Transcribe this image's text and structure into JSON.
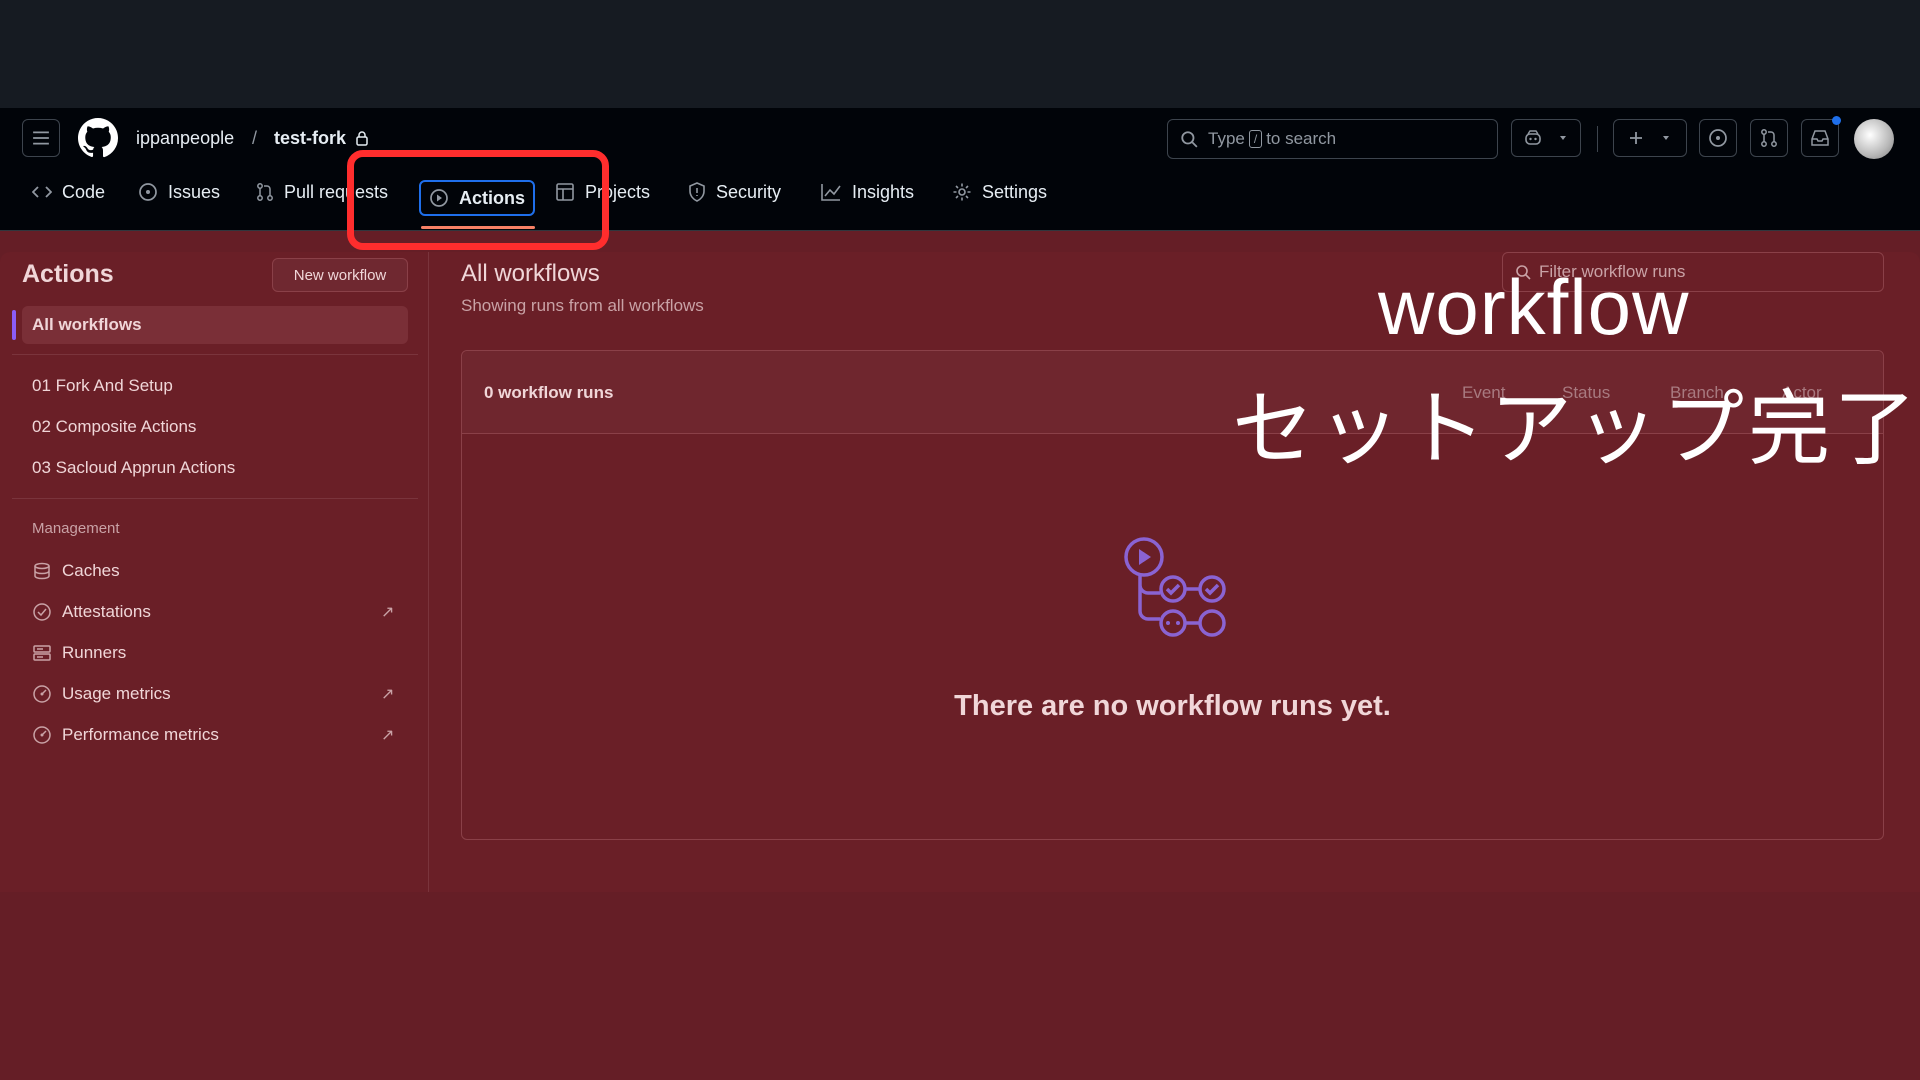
{
  "header": {
    "owner": "ippanpeople",
    "separator": "/",
    "repo": "test-fork",
    "search_prefix": "Type",
    "search_key": "/",
    "search_suffix": "to search"
  },
  "nav": {
    "tabs": [
      {
        "label": "Code",
        "icon": "code-icon"
      },
      {
        "label": "Issues",
        "icon": "issue-icon"
      },
      {
        "label": "Pull requests",
        "icon": "pull-request-icon"
      },
      {
        "label": "Actions",
        "icon": "play-icon",
        "active": true
      },
      {
        "label": "Projects",
        "icon": "table-icon"
      },
      {
        "label": "Security",
        "icon": "shield-icon"
      },
      {
        "label": "Insights",
        "icon": "graph-icon"
      },
      {
        "label": "Settings",
        "icon": "gear-icon"
      }
    ]
  },
  "sidebar": {
    "title": "Actions",
    "new_workflow": "New workflow",
    "all_workflows": "All workflows",
    "workflows": [
      "01 Fork And Setup",
      "02 Composite Actions",
      "03 Sacloud Apprun Actions"
    ],
    "management_label": "Management",
    "management": [
      {
        "label": "Caches",
        "icon": "database-icon",
        "external": false
      },
      {
        "label": "Attestations",
        "icon": "verified-icon",
        "external": true
      },
      {
        "label": "Runners",
        "icon": "server-icon",
        "external": false
      },
      {
        "label": "Usage metrics",
        "icon": "meter-icon",
        "external": true
      },
      {
        "label": "Performance metrics",
        "icon": "meter-icon",
        "external": true
      }
    ]
  },
  "main": {
    "title": "All workflows",
    "subtitle": "Showing runs from all workflows",
    "filter_placeholder": "Filter workflow runs",
    "runs_count": "0 workflow runs",
    "filters": [
      "Event",
      "Status",
      "Branch",
      "Actor"
    ],
    "empty_message": "There are no workflow runs yet."
  },
  "overlay": {
    "line1": "workflow",
    "line2": "セットアップ完了"
  },
  "colors": {
    "header_bg": "#010409",
    "overlay_tint": "#651e26",
    "annotation_red": "#ff2d2d",
    "active_blue": "#1f6feb",
    "tab_underline": "#f78166"
  }
}
